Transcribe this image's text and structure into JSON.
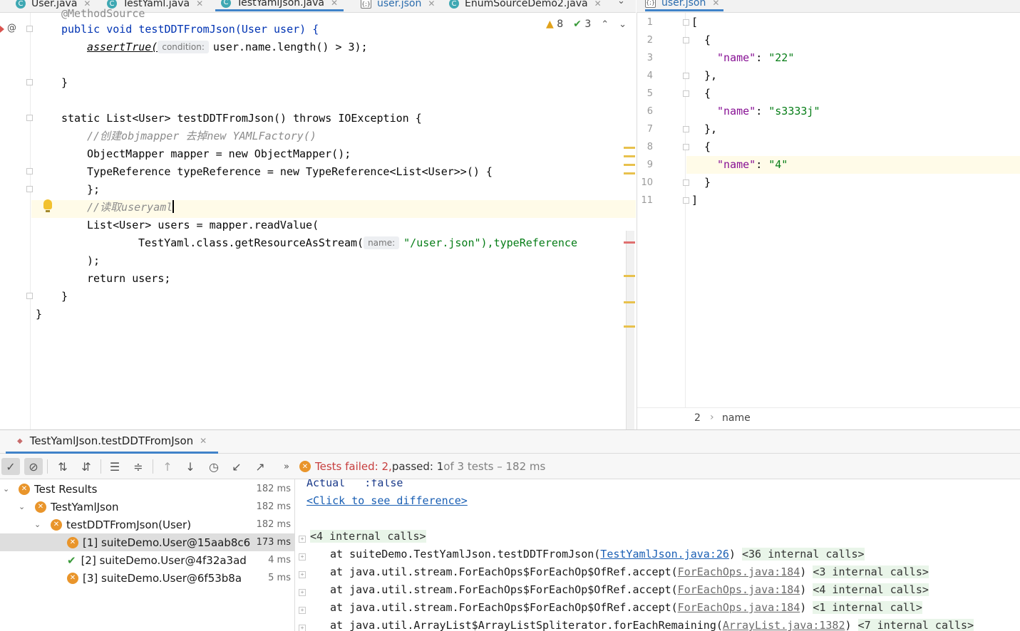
{
  "tabs_left": [
    {
      "label": "User.java",
      "kind": "class"
    },
    {
      "label": "TestYaml.java",
      "kind": "class"
    },
    {
      "label": "TestYamlJson.java",
      "kind": "class",
      "active": true
    },
    {
      "label": "user.json",
      "kind": "json"
    },
    {
      "label": "EnumSourceDemo2.java",
      "kind": "class"
    }
  ],
  "tabs_right": [
    {
      "label": "user.json",
      "kind": "json",
      "active": true
    }
  ],
  "inspections": {
    "warnings": "8",
    "typos": "3"
  },
  "editor_left": {
    "lines": [
      "@MethodSource",
      "public void testDDTFromJson(User user) {",
      "assertTrue(",
      "condition:",
      "user.name.length() > 3);",
      "}",
      "static List<User> testDDTFromJson() throws IOException {",
      "//创建objmapper 去掉new YAMLFactory()",
      "ObjectMapper mapper = new ObjectMapper();",
      "TypeReference typeReference = new TypeReference<List<User>>() {",
      "};",
      "//读取useryaml",
      "List<User> users = mapper.readValue(",
      "TestYaml.class.getResourceAsStream(",
      "name:",
      "\"/user.json\"),typeReference",
      ");",
      "return users;",
      "}",
      "}"
    ]
  },
  "editor_right": {
    "line_numbers": [
      "1",
      "2",
      "3",
      "4",
      "5",
      "6",
      "7",
      "8",
      "9",
      "10",
      "11"
    ],
    "lines": [
      "[",
      "{",
      "\"name\"",
      "\"22\"",
      "},",
      "{",
      "\"name\"",
      "\"s3333j\"",
      "},",
      "{",
      "\"name\"",
      "\"4\"",
      "}",
      "]"
    ],
    "breadcrumb": {
      "index": "2",
      "sep": "›",
      "key": "name"
    }
  },
  "run": {
    "tab_label": "TestYamlJson.testDDTFromJson",
    "status_failed": "Tests failed: 2,",
    "status_passed": " passed: 1",
    "status_rest": " of 3 tests – 182 ms"
  },
  "tree": [
    {
      "label": "Test Results",
      "time": "182 ms",
      "status": "failed"
    },
    {
      "label": "TestYamlJson",
      "time": "182 ms",
      "status": "failed"
    },
    {
      "label": "testDDTFromJson(User)",
      "time": "182 ms",
      "status": "failed"
    },
    {
      "label": "[1] suiteDemo.User@15aab8c6",
      "time": "173 ms",
      "status": "failed",
      "selected": true
    },
    {
      "label": "[2] suiteDemo.User@4f32a3ad",
      "time": "4 ms",
      "status": "passed"
    },
    {
      "label": "[3] suiteDemo.User@6f53b8a",
      "time": "5 ms",
      "status": "failed"
    }
  ],
  "console": {
    "actual": "Actual   :false",
    "diff_link": "<Click to see difference>",
    "internal_first": "<4 internal calls>",
    "frames": [
      {
        "at": "at suiteDemo.TestYamlJson.testDDTFromJson(",
        "src": "TestYamlJson.java:26",
        "close": ")",
        "calls": "<36 internal calls>",
        "blue": true
      },
      {
        "at": "at java.util.stream.ForEachOps$ForEachOp$OfRef.accept(",
        "src": "ForEachOps.java:184",
        "close": ")",
        "calls": "<3 internal calls>"
      },
      {
        "at": "at java.util.stream.ForEachOps$ForEachOp$OfRef.accept(",
        "src": "ForEachOps.java:184",
        "close": ")",
        "calls": "<4 internal calls>"
      },
      {
        "at": "at java.util.stream.ForEachOps$ForEachOp$OfRef.accept(",
        "src": "ForEachOps.java:184",
        "close": ")",
        "calls": "<1 internal call>"
      },
      {
        "at": "at java.util.ArrayList$ArrayListSpliterator.forEachRemaining(",
        "src": "ArrayList.java:1382",
        "close": ")",
        "calls": "<7 internal calls>"
      }
    ]
  }
}
